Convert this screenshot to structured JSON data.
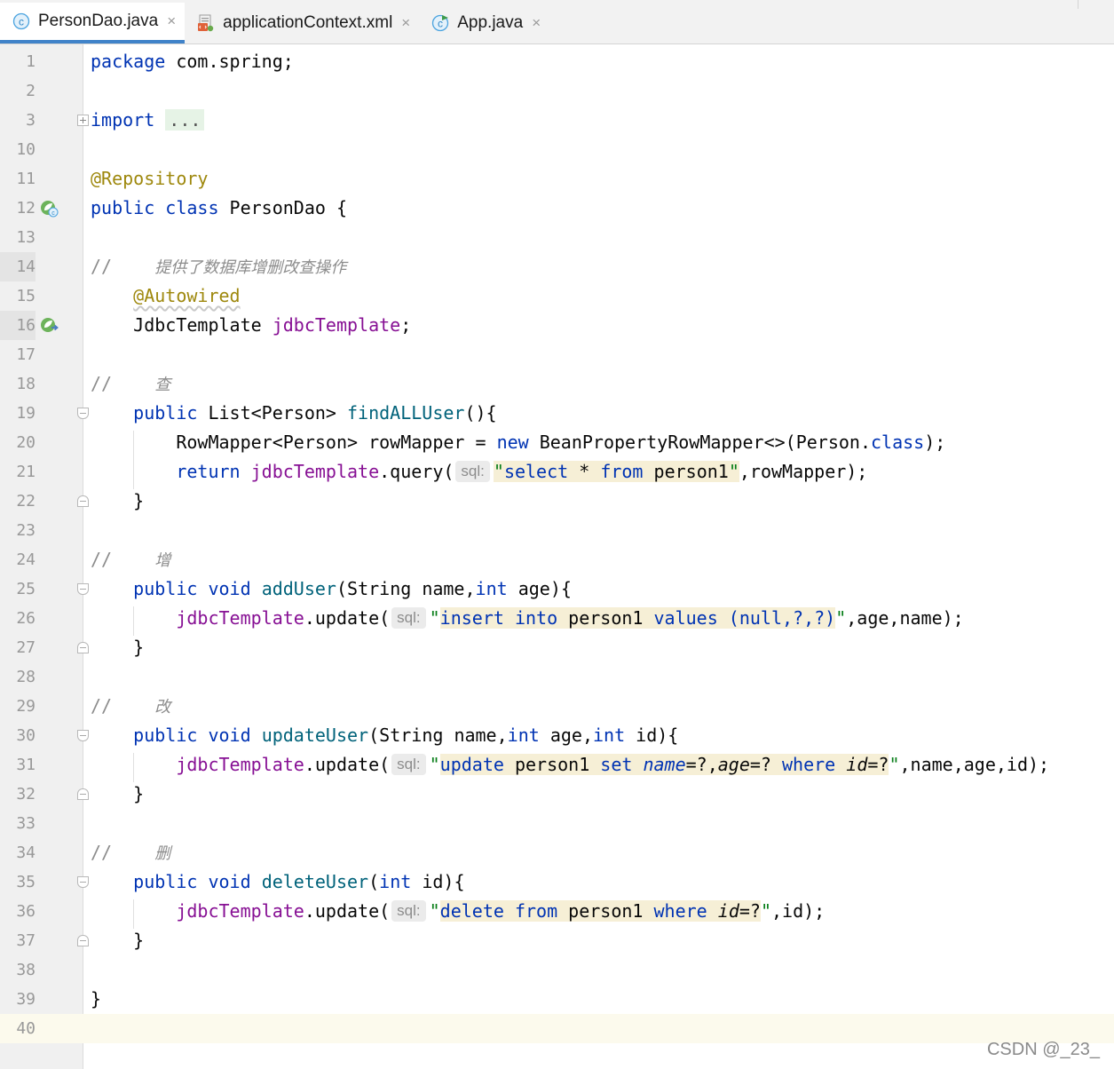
{
  "tabs": [
    {
      "label": "PersonDao.java",
      "icon": "java-class-icon",
      "active": true
    },
    {
      "label": "applicationContext.xml",
      "icon": "xml-file-icon",
      "active": false
    },
    {
      "label": "App.java",
      "icon": "java-app-class-icon",
      "active": false
    }
  ],
  "close_glyph": "×",
  "line_numbers": [
    "1",
    "2",
    "3",
    "10",
    "11",
    "12",
    "13",
    "14",
    "15",
    "16",
    "17",
    "18",
    "19",
    "20",
    "21",
    "22",
    "23",
    "24",
    "25",
    "26",
    "27",
    "28",
    "29",
    "30",
    "31",
    "32",
    "33",
    "34",
    "35",
    "36",
    "37",
    "38",
    "39",
    "40"
  ],
  "code": {
    "l1_kw": "package",
    "l1_rest": " com.spring;",
    "l3_kw": "import",
    "l3_fold": "...",
    "l11": "@Repository",
    "l12_kw1": "public",
    "l12_kw2": "class",
    "l12_name": " PersonDao {",
    "comment_slash": "//",
    "l14_cn": "提供了数据库增删改查操作",
    "l15": "@Autowired",
    "l16_type": "JdbcTemplate ",
    "l16_field": "jdbcTemplate",
    "l16_end": ";",
    "l18_cn": "查",
    "l19_kw": "public",
    "l19_type": " List<Person> ",
    "l19_mth": "findALLUser",
    "l19_end": "(){",
    "l20_a": "RowMapper<Person> rowMapper = ",
    "l20_new": "new",
    "l20_b": " BeanPropertyRowMapper<>(Person.",
    "l20_cls": "class",
    "l20_c": ");",
    "l21_kw": "return",
    "jdbc_field": "jdbcTemplate",
    "l21_call": ".query(",
    "sql_hint": "sql:",
    "quote": "\"",
    "l21_sql_select": "select",
    "l21_sql_star": " * ",
    "l21_sql_from": "from",
    "l21_sql_tbl": " person1",
    "l21_end": ",rowMapper);",
    "close_brace": "}",
    "l24_cn": "增",
    "kw_public": "public",
    "kw_void": "void",
    "kw_int": "int",
    "l25_mth": "addUser",
    "l25_p1": "(String name,",
    "l25_p2": " age){",
    "call_update": ".update(",
    "l26_insert": "insert",
    "l26_into": "into",
    "l26_tbl": " person1 ",
    "l26_values": "values",
    "l26_args": " (null,?,?)",
    "l26_end": ",age,name);",
    "l29_cn": "改",
    "l30_mth": "updateUser",
    "l30_p1": "(String name,",
    "l30_p2": " age,",
    "l30_p3": " id){",
    "l31_update": "update",
    "l31_tbl": " person1 ",
    "l31_set": "set",
    "l31_name": "name",
    "l31_eq1": "=?,",
    "l31_age": "age",
    "l31_eq2": "=? ",
    "l31_where": "where",
    "l31_id": "id",
    "l31_eq3": "=?",
    "l31_end": ",name,age,id);",
    "l34_cn": "删",
    "l35_mth": "deleteUser",
    "l35_p1": "(",
    "l35_p2": " id){",
    "l36_delete": "delete",
    "l36_from": "from",
    "l36_tbl": " person1 ",
    "l36_where": "where",
    "l36_id": "id",
    "l36_eq": "=?",
    "l36_end": ",id);"
  },
  "watermark": "CSDN @_23_",
  "colors": {
    "keyword": "#0033b3",
    "annotation": "#9e880d",
    "field": "#871094",
    "method": "#00627a",
    "comment": "#8c8c8c",
    "string": "#067d17",
    "sql_bg": "#f6efd6",
    "tab_underline": "#4083c9"
  }
}
